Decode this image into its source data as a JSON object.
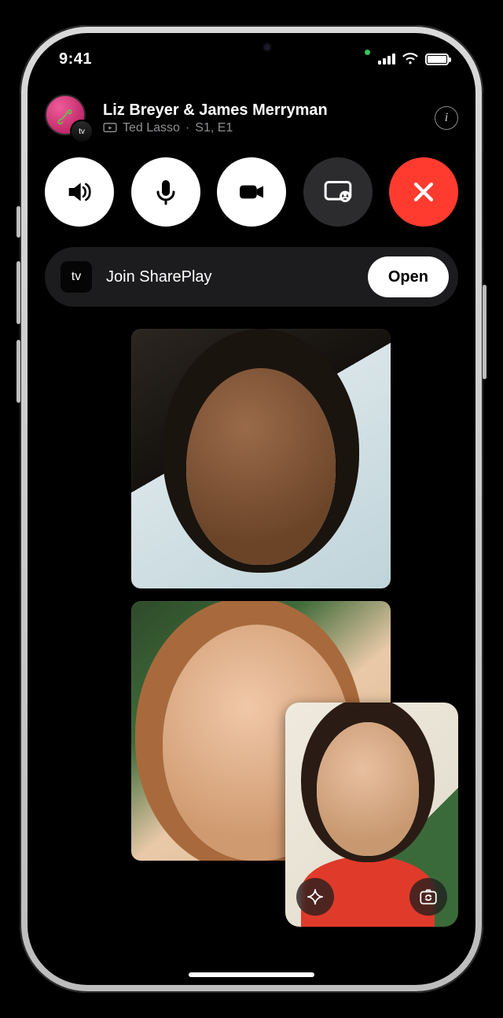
{
  "statusbar": {
    "time": "9:41"
  },
  "call": {
    "participants_title": "Liz Breyer & James Merryman",
    "media_title": "Ted Lasso",
    "media_episode": "S1, E1",
    "avatar_sub_label": "tv"
  },
  "shareplay": {
    "app_label": "tv",
    "prompt": "Join SharePlay",
    "open_label": "Open"
  },
  "info_glyph": "i",
  "dot": "·"
}
